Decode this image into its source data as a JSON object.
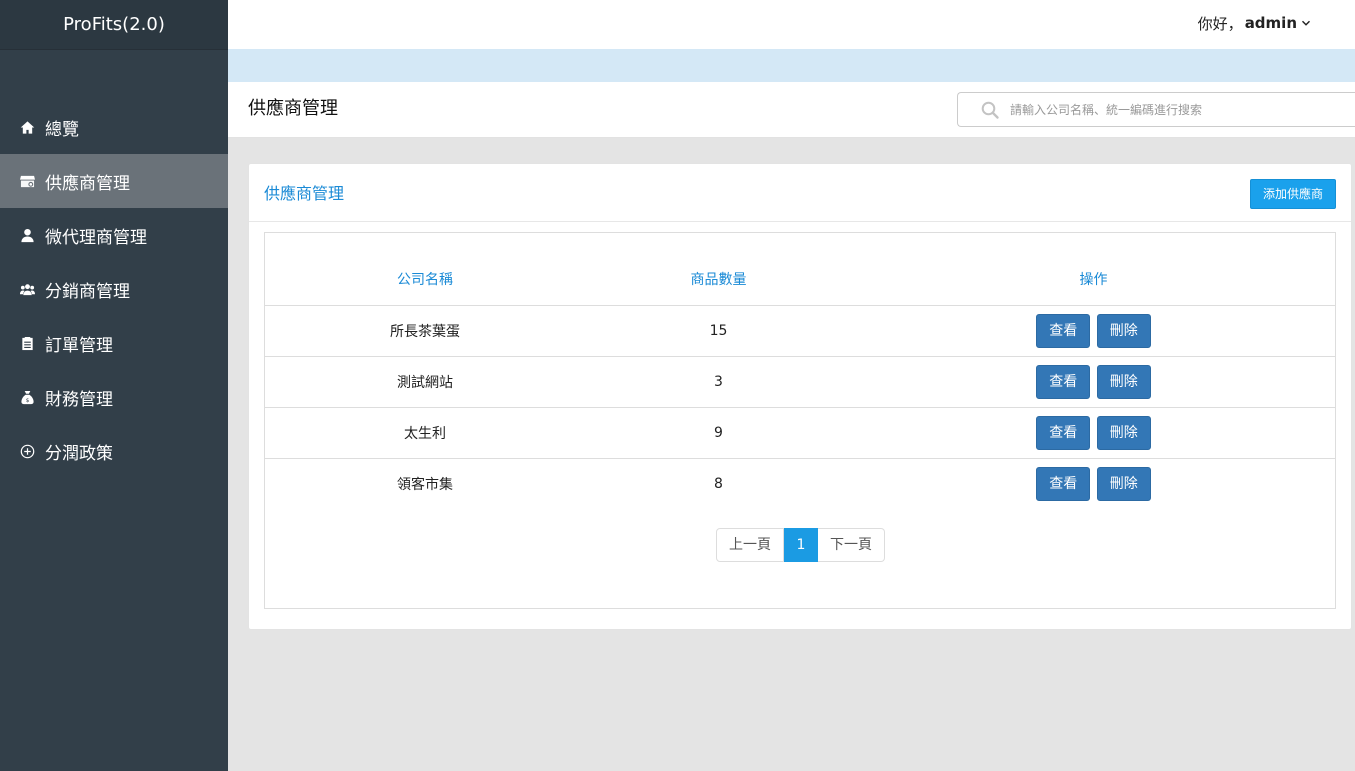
{
  "app": {
    "brand": "ProFits(2.0)"
  },
  "user": {
    "greeting": "你好，",
    "name": "admin"
  },
  "sidebar": {
    "items": [
      {
        "label": "總覽",
        "icon": "home-icon",
        "active": false
      },
      {
        "label": "供應商管理",
        "icon": "store-icon",
        "active": true
      },
      {
        "label": "微代理商管理",
        "icon": "user-icon",
        "active": false
      },
      {
        "label": "分銷商管理",
        "icon": "users-icon",
        "active": false
      },
      {
        "label": "訂單管理",
        "icon": "clipboard-icon",
        "active": false
      },
      {
        "label": "財務管理",
        "icon": "money-bag-icon",
        "active": false
      },
      {
        "label": "分潤政策",
        "icon": "plus-circle-icon",
        "active": false
      }
    ]
  },
  "page": {
    "title": "供應商管理"
  },
  "search": {
    "placeholder": "請輸入公司名稱、統一編碼進行搜索",
    "value": ""
  },
  "panel": {
    "title": "供應商管理",
    "add_label": "添加供應商",
    "columns": [
      "公司名稱",
      "商品數量",
      "操作"
    ],
    "rows": [
      {
        "company": "所長茶葉蛋",
        "count": "15",
        "view": "查看",
        "delete": "刪除"
      },
      {
        "company": "測試網站",
        "count": "3",
        "view": "查看",
        "delete": "刪除"
      },
      {
        "company": "太生利",
        "count": "9",
        "view": "查看",
        "delete": "刪除"
      },
      {
        "company": "領客市集",
        "count": "8",
        "view": "查看",
        "delete": "刪除"
      }
    ]
  },
  "pagination": {
    "prev": "上一頁",
    "current": "1",
    "next": "下一頁"
  },
  "colors": {
    "sidebar_bg": "#323f49",
    "sidebar_active": "#6a7279",
    "accent_blue": "#1a8ad6",
    "button_blue": "#3377b6",
    "add_button": "#1aa1ec",
    "info_strip": "#d4e8f6"
  }
}
